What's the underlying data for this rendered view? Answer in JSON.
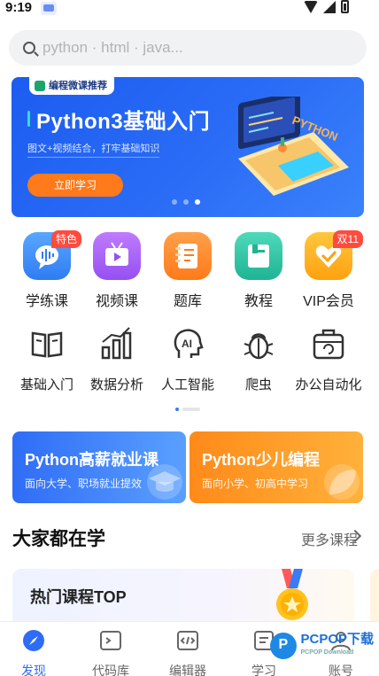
{
  "status_bar": {
    "time": "9:19"
  },
  "search": {
    "placeholder": "python · html · java..."
  },
  "banner": {
    "tag": "编程微课推荐",
    "title": "Python3基础入门",
    "subtitle": "图文+视频结合，打牢基础知识",
    "button_label": "立即学习",
    "illustration_text": "PYTHON",
    "dots": 3,
    "active_dot": 2
  },
  "primary_grid": [
    {
      "label": "学练课",
      "icon": "chat-wave-icon",
      "color": "#3d8ef8",
      "badge": "特色"
    },
    {
      "label": "视频课",
      "icon": "video-tv-icon",
      "color": "#a85cf6",
      "badge": ""
    },
    {
      "label": "题库",
      "icon": "notebook-icon",
      "color": "#ff8a2a",
      "badge": ""
    },
    {
      "label": "教程",
      "icon": "book-icon",
      "color": "#2bc4a6",
      "badge": ""
    },
    {
      "label": "VIP会员",
      "icon": "vip-heart-icon",
      "color": "#ffb21c",
      "badge": "双11"
    }
  ],
  "secondary_grid": [
    {
      "label": "基础入门",
      "icon": "open-book-icon"
    },
    {
      "label": "数据分析",
      "icon": "bar-chart-icon"
    },
    {
      "label": "人工智能",
      "icon": "ai-head-icon"
    },
    {
      "label": "爬虫",
      "icon": "bug-icon"
    },
    {
      "label": "办公自动化",
      "icon": "briefcase-icon"
    }
  ],
  "promo_cards": [
    {
      "title": "Python高薪就业课",
      "subtitle": "面向大学、职场就业提效"
    },
    {
      "title": "Python少儿编程",
      "subtitle": "面向小学、初高中学习"
    }
  ],
  "section": {
    "title": "大家都在学",
    "more_label": "更多课程"
  },
  "hot_card": {
    "title": "热门课程TOP"
  },
  "bottom_nav": [
    {
      "label": "发现",
      "icon": "compass-icon",
      "active": true
    },
    {
      "label": "代码库",
      "icon": "terminal-icon",
      "active": false
    },
    {
      "label": "编辑器",
      "icon": "code-editor-icon",
      "active": false
    },
    {
      "label": "学习",
      "icon": "study-icon",
      "active": false
    },
    {
      "label": "账号",
      "icon": "user-icon",
      "active": false
    }
  ],
  "watermark": {
    "brand": "PCPOP下载",
    "sub": "PCPOP Download"
  },
  "colors": {
    "accent": "#2f6cf6",
    "orange": "#ff7a1a",
    "badge_red": "#ff4b3e"
  }
}
